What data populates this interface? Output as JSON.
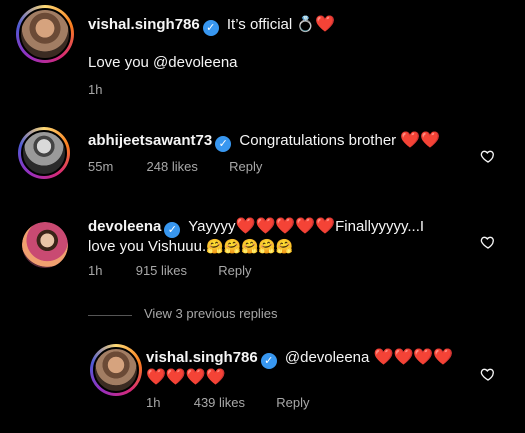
{
  "caption": {
    "username": "vishal.singh786",
    "text": "It’s official",
    "ring_emoji": "💍",
    "heart_emoji": "❤️",
    "second_line": "Love you @devoleena",
    "time": "1h"
  },
  "comments": [
    {
      "username": "abhijeetsawant73",
      "text": "Congratulations brother",
      "hearts": "❤️❤️",
      "time": "55m",
      "likes": "248 likes",
      "reply": "Reply"
    },
    {
      "username": "devoleena",
      "text_start": "Yayyyy",
      "hearts_mid": "❤️❤️❤️❤️❤️",
      "text_end": "Finallyyyyy...I",
      "line2": "love you Vishuuu.",
      "hug_emojis": "🤗🤗🤗🤗🤗",
      "time": "1h",
      "likes": "915 likes",
      "reply": "Reply"
    }
  ],
  "view_replies": "View 3 previous replies",
  "reply": {
    "username": "vishal.singh786",
    "mention": "@devoleena",
    "hearts_line1": "❤️❤️❤️❤️",
    "hearts_line2": "❤️❤️❤️❤️",
    "time": "1h",
    "likes": "439 likes",
    "reply": "Reply"
  },
  "icons": {
    "verified": "verified-badge-icon",
    "like": "heart-outline-icon"
  },
  "colors": {
    "background": "#000000",
    "text": "#f5f5f5",
    "meta": "#a8a8a8",
    "verified": "#3897f0",
    "heart": "#e0245e"
  }
}
